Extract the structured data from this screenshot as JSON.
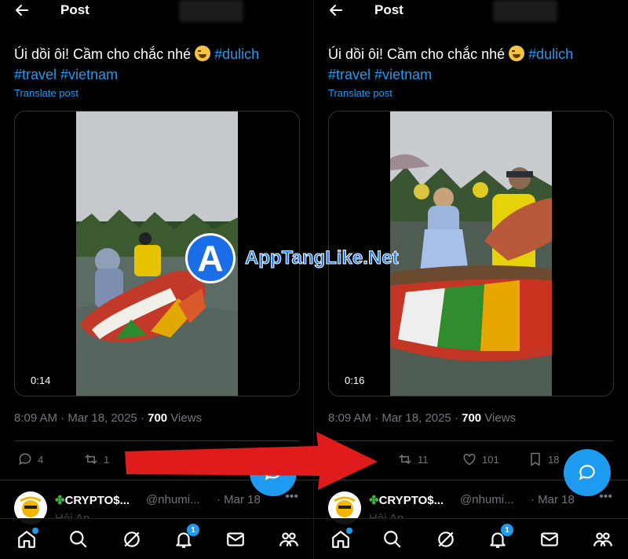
{
  "header": {
    "title": "Post"
  },
  "post": {
    "text_main": "Úi dồi ôi! Cầm cho chắc nhé ",
    "tags": [
      "#dulich",
      "#travel",
      "#vietnam"
    ],
    "translate": "Translate post",
    "time": "8:09 AM",
    "date": "Mar 18, 2025",
    "views_count": "700",
    "views_label": "Views"
  },
  "panels": {
    "left": {
      "duration": "0:14",
      "replies": "4",
      "reposts": "1"
    },
    "right": {
      "duration": "0:16",
      "reposts": "11",
      "likes": "101",
      "bookmarks": "18"
    }
  },
  "reply": {
    "name": "CRYPTO$...",
    "handle": "@nhumi...",
    "date": "· Mar 18",
    "body": "Hội An",
    "more": "•••"
  },
  "nav": {
    "notifications_badge": "1"
  },
  "watermark": {
    "letter": "A",
    "text": "AppTangLike.Net"
  },
  "colors": {
    "accent": "#1d9bf0",
    "background": "#000000",
    "muted": "#71767b",
    "arrow": "#e01b1b"
  }
}
